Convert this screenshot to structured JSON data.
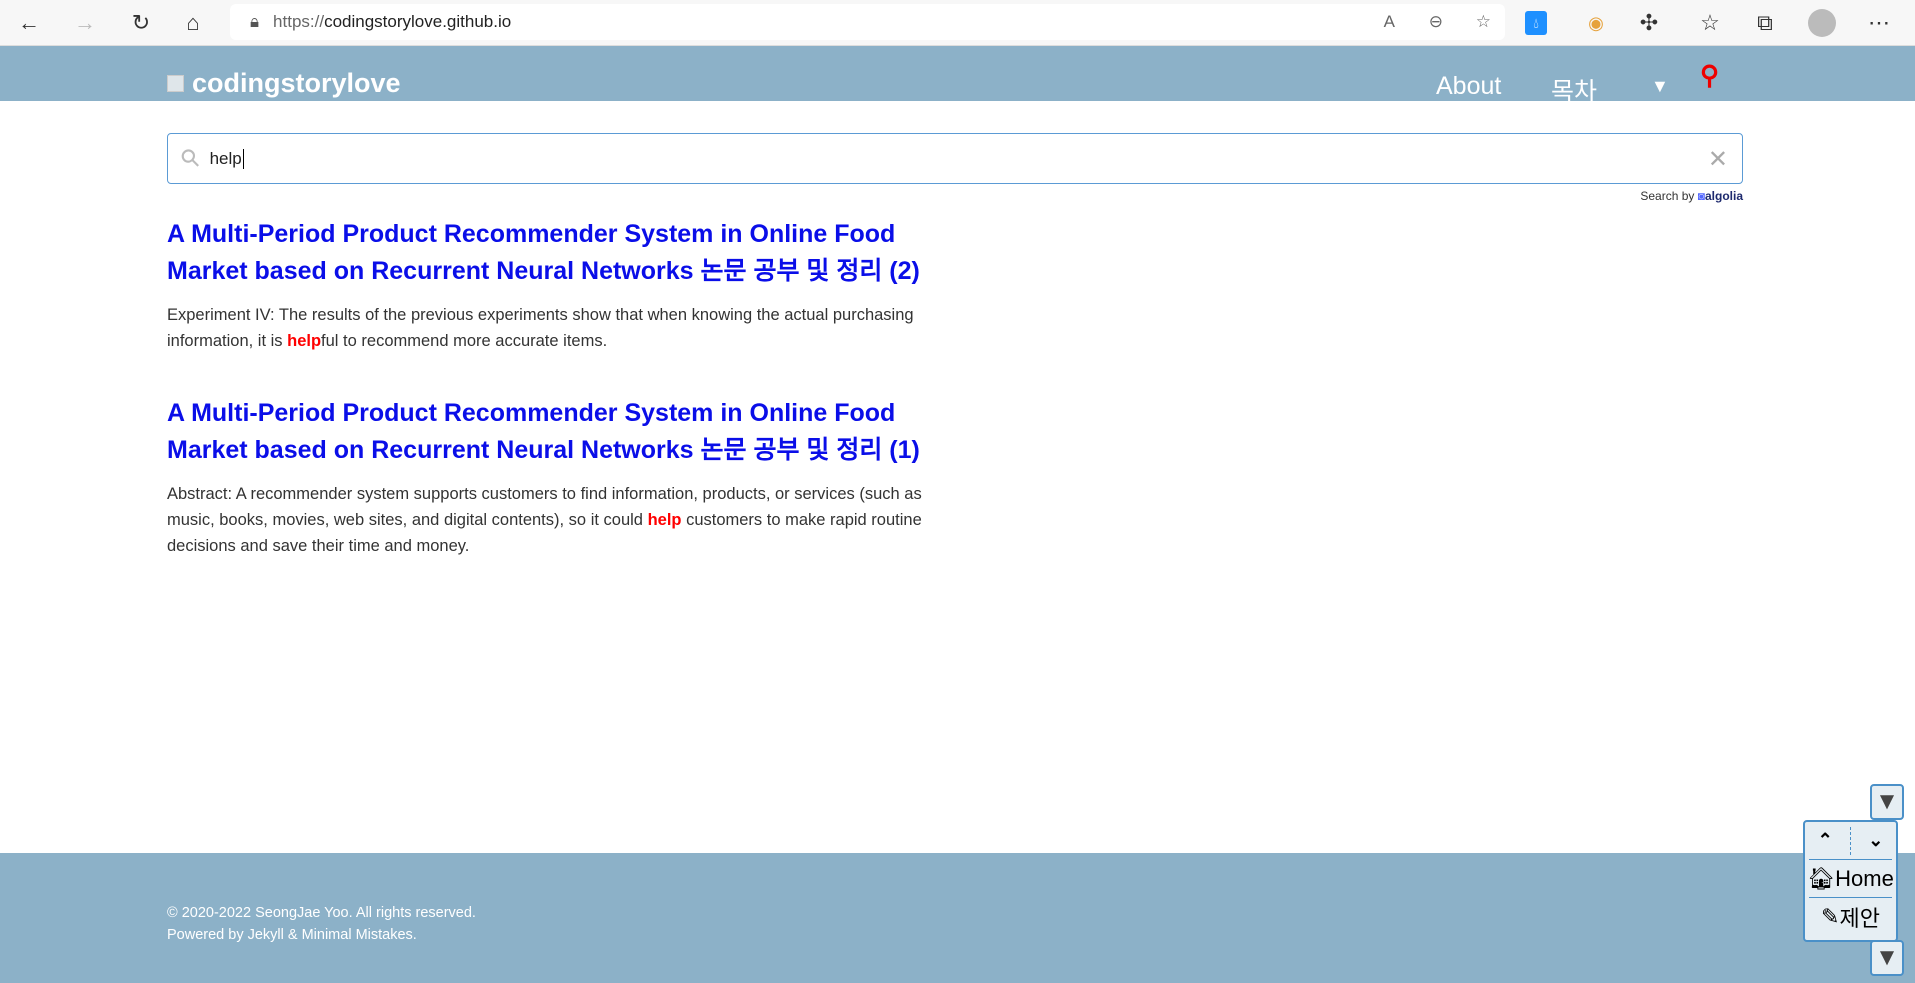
{
  "browser": {
    "url_protocol": "https://",
    "url_host": "codingstorylove.github.io"
  },
  "site": {
    "title": "codingstorylove",
    "nav": [
      "About",
      "목차"
    ]
  },
  "search": {
    "query": "help",
    "powered_by": "Search by",
    "powered_brand": "algolia"
  },
  "results": [
    {
      "title": "A Multi-Period Product Recommender System in Online Food Market based on Recurrent Neural Networks 논문 공부 및 정리 (2)",
      "pre": "Experiment IV: The results of the previous experiments show that when knowing the actual purchasing information, it is ",
      "hit": "help",
      "post": "ful to recommend more accurate items."
    },
    {
      "title": "A Multi-Period Product Recommender System in Online Food Market based on Recurrent Neural Networks 논문 공부 및 정리 (1)",
      "pre": "Abstract: A recommender system supports customers to find information, products, or services (such as music, books, movies, web sites, and digital contents), so it could ",
      "hit": "help",
      "post": " customers to make rapid routine decisions and save their time and money."
    }
  ],
  "footer": {
    "copyright": "© 2020-2022 SeongJae Yoo. All rights reserved.",
    "powered": "Powered by Jekyll & Minimal Mistakes."
  },
  "widget": {
    "home": "Home",
    "suggest": "제안"
  },
  "colors": {
    "masthead": "#8cb1c8",
    "link": "#0a0ee8",
    "highlight": "#ff0000"
  }
}
